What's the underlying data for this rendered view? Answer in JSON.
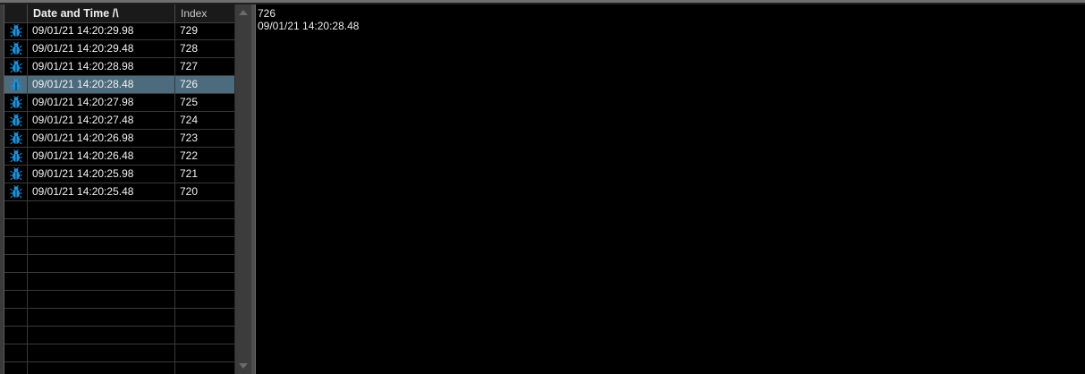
{
  "list": {
    "columns": {
      "date_time": "Date and Time  /\\",
      "index": "Index"
    },
    "rows": [
      {
        "date_time": "09/01/21 14:20:29.98",
        "index": "729",
        "icon": "bug-icon"
      },
      {
        "date_time": "09/01/21 14:20:29.48",
        "index": "728",
        "icon": "bug-icon"
      },
      {
        "date_time": "09/01/21 14:20:28.98",
        "index": "727",
        "icon": "bug-icon"
      },
      {
        "date_time": "09/01/21 14:20:28.48",
        "index": "726",
        "icon": "bug-icon"
      },
      {
        "date_time": "09/01/21 14:20:27.98",
        "index": "725",
        "icon": "bug-icon"
      },
      {
        "date_time": "09/01/21 14:20:27.48",
        "index": "724",
        "icon": "bug-icon"
      },
      {
        "date_time": "09/01/21 14:20:26.98",
        "index": "723",
        "icon": "bug-icon"
      },
      {
        "date_time": "09/01/21 14:20:26.48",
        "index": "722",
        "icon": "bug-icon"
      },
      {
        "date_time": "09/01/21 14:20:25.98",
        "index": "721",
        "icon": "bug-icon"
      },
      {
        "date_time": "09/01/21 14:20:25.48",
        "index": "720",
        "icon": "bug-icon"
      }
    ],
    "selected_index": "726"
  },
  "detail": {
    "line1": "726",
    "line2": "09/01/21 14:20:28.48"
  },
  "colors": {
    "selected_row": "#4c6b7c",
    "icon": "#1e8fd8",
    "background": "#000000"
  }
}
